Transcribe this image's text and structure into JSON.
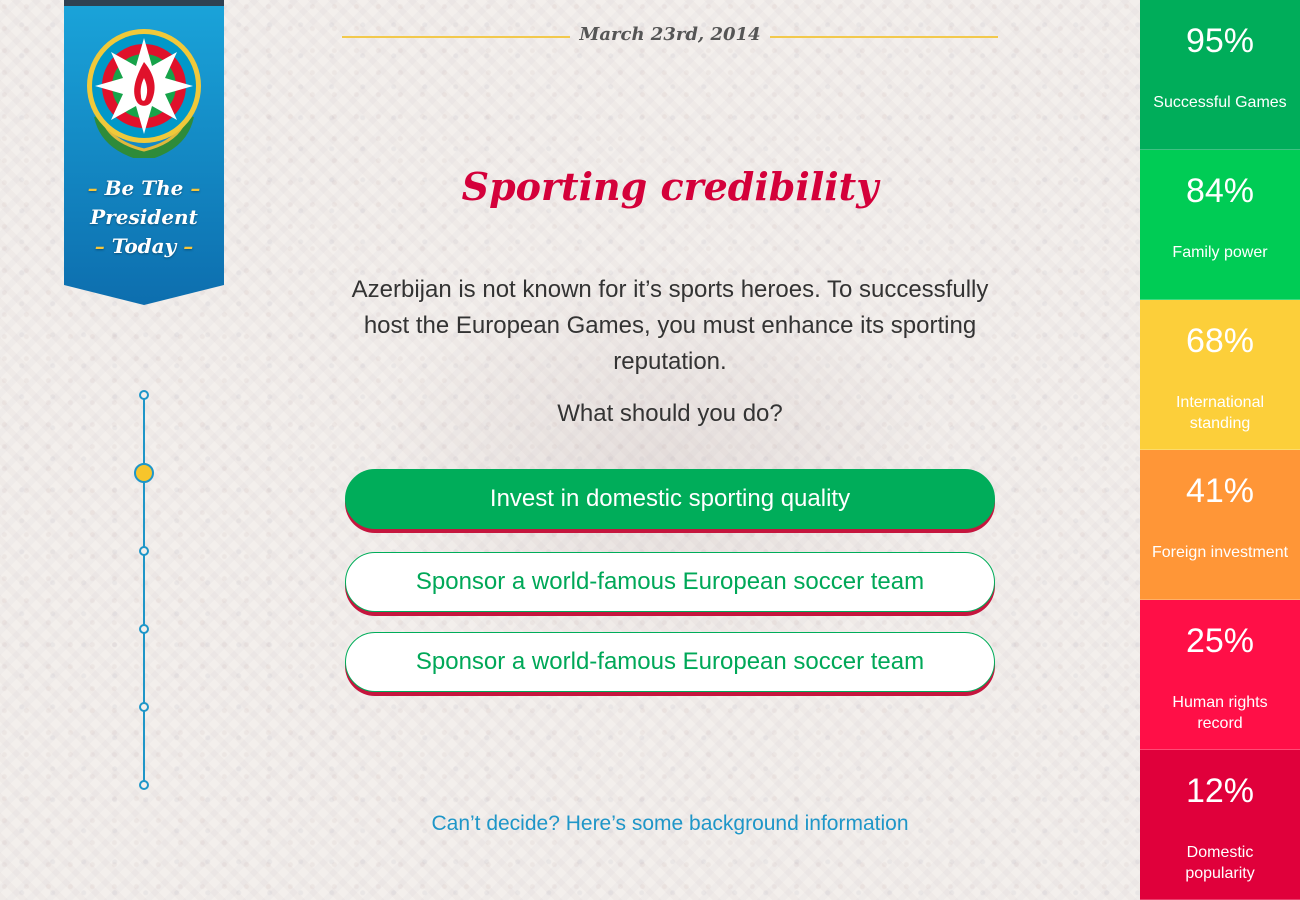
{
  "banner": {
    "line1": "Be The",
    "line2": "President",
    "line3": "Today",
    "dash": "–"
  },
  "timeline": {
    "total_steps": 6,
    "current_step": 2
  },
  "header": {
    "date": "March 23rd, 2014"
  },
  "question": {
    "title": "Sporting credibility",
    "description": "Azerbijan is not known for it’s sports heroes. To successfully host the European Games, you must enhance its sporting reputation.",
    "prompt": "What should you do?",
    "options": [
      {
        "label": "Invest in domestic sporting quality",
        "selected": true
      },
      {
        "label": "Sponsor a world-famous European soccer team",
        "selected": false
      },
      {
        "label": "Sponsor a world-famous European soccer team",
        "selected": false
      }
    ]
  },
  "background_link": "Can’t decide? Here’s some background information",
  "stats": [
    {
      "value": "95%",
      "label": "Successful Games",
      "color": "#00ad5a"
    },
    {
      "value": "84%",
      "label": "Family power",
      "color": "#00cc55"
    },
    {
      "value": "68%",
      "label": "International standing",
      "color": "#fccf3a"
    },
    {
      "value": "41%",
      "label": "Foreign investment",
      "color": "#ff9637"
    },
    {
      "value": "25%",
      "label": "Human rights record",
      "color": "#ff0f47"
    },
    {
      "value": "12%",
      "label": "Domestic popularity",
      "color": "#e0003b"
    }
  ],
  "colors": {
    "title": "#d4003a",
    "primary_green": "#00ad5a",
    "link_blue": "#1e96c8",
    "banner_blue": "#1a8fcb",
    "gold": "#f2c94c"
  }
}
